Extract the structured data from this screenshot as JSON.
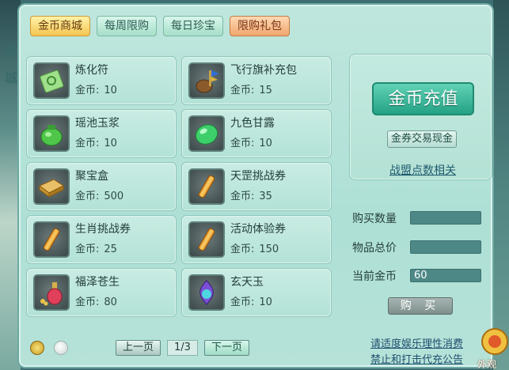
{
  "background": {
    "left_text_1": "商",
    "left_text_2": "城"
  },
  "tabs": [
    {
      "label": "金币商城",
      "active": true
    },
    {
      "label": "每周限购",
      "active": false
    },
    {
      "label": "每日珍宝",
      "active": false
    },
    {
      "label": "限购礼包",
      "active": false
    }
  ],
  "price_label": "金币:",
  "items": [
    {
      "name": "炼化符",
      "price": "10",
      "icon": "talisman-icon"
    },
    {
      "name": "飞行旗补充包",
      "price": "15",
      "icon": "flag-pouch-icon"
    },
    {
      "name": "瑶池玉浆",
      "price": "10",
      "icon": "green-jar-icon"
    },
    {
      "name": "九色甘露",
      "price": "10",
      "icon": "green-gem-icon"
    },
    {
      "name": "聚宝盒",
      "price": "500",
      "icon": "treasure-box-icon"
    },
    {
      "name": "天罡挑战券",
      "price": "35",
      "icon": "scroll-icon"
    },
    {
      "name": "生肖挑战券",
      "price": "25",
      "icon": "scroll-icon"
    },
    {
      "name": "活动体验券",
      "price": "150",
      "icon": "scroll-icon"
    },
    {
      "name": "福泽苍生",
      "price": "80",
      "icon": "potion-icon"
    },
    {
      "name": "玄天玉",
      "price": "10",
      "icon": "purple-jade-icon"
    }
  ],
  "pager": {
    "prev": "上一页",
    "page": "1/3",
    "next": "下一页"
  },
  "recharge": {
    "button": "金币充值",
    "exchange": "金券交易现金",
    "alliance_link": "战盟点数相关"
  },
  "purchase": {
    "quantity_label": "购买数量",
    "quantity_value": "",
    "total_label": "物品总价",
    "total_value": "",
    "current_label": "当前金币",
    "current_value": "60",
    "buy_button": "购 买"
  },
  "notices": {
    "line1": "请适度娱乐理性消费",
    "line2": "禁止和打击代充公告"
  },
  "corner_label": "外观"
}
